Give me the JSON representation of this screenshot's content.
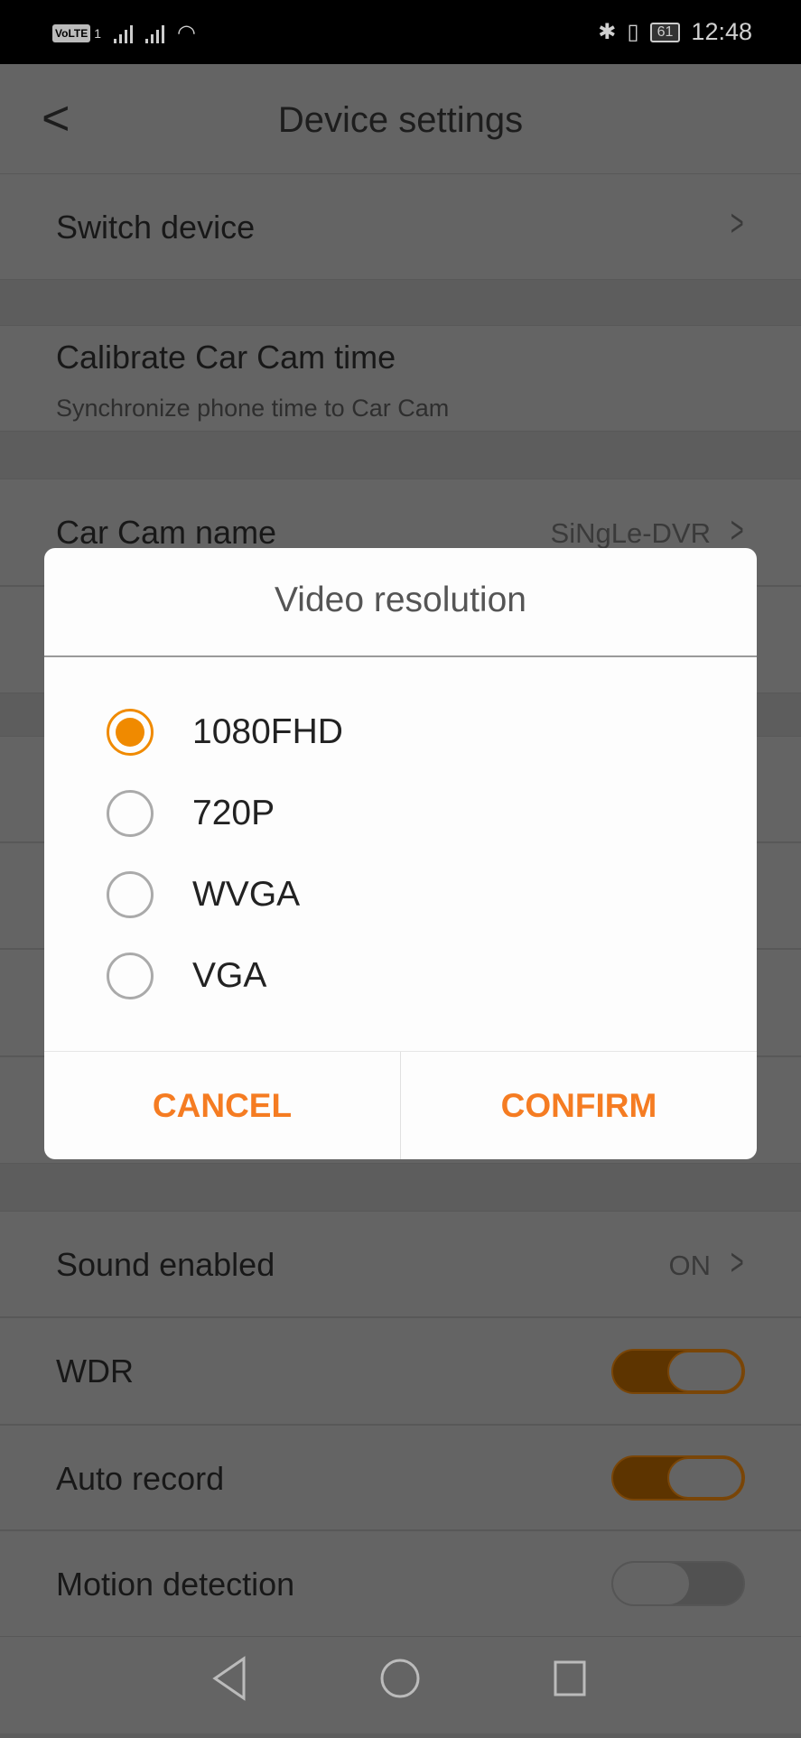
{
  "status_bar": {
    "volte": "VoLTE",
    "sim": "1",
    "battery": "61",
    "time": "12:48"
  },
  "header": {
    "title": "Device settings"
  },
  "settings": {
    "switch_device": "Switch device",
    "calibrate": {
      "label": "Calibrate Car Cam time",
      "sub": "Synchronize phone time to Car Cam"
    },
    "car_cam_name": {
      "label": "Car Cam name",
      "value": "SiNgLe-DVR"
    },
    "sound": {
      "label": "Sound enabled",
      "value": "ON"
    },
    "wdr": {
      "label": "WDR",
      "on": true
    },
    "auto_record": {
      "label": "Auto record",
      "on": true
    },
    "motion": {
      "label": "Motion detection",
      "on": false
    }
  },
  "dialog": {
    "title": "Video resolution",
    "options": [
      "1080FHD",
      "720P",
      "WVGA",
      "VGA"
    ],
    "selected": "1080FHD",
    "cancel": "CANCEL",
    "confirm": "CONFIRM",
    "accent": "#f57c22"
  }
}
